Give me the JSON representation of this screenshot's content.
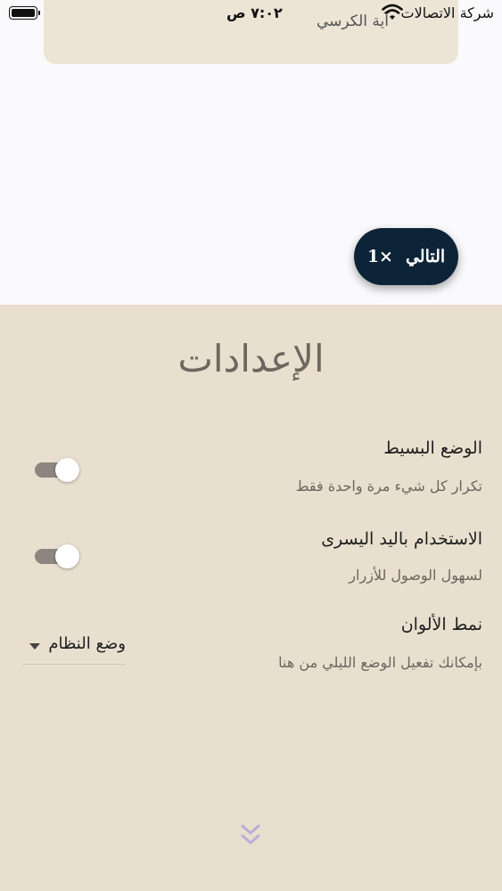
{
  "status_bar": {
    "carrier": "شركة الاتصالات",
    "time": "٧:٠٢ ص"
  },
  "card": {
    "title": "آية الكرسي"
  },
  "next_button": {
    "label": "التالي",
    "speed": "×1"
  },
  "settings": {
    "title": "الإعدادات",
    "rows": [
      {
        "title": "الوضع البسيط",
        "subtitle": "تكرار كل شيء مرة واحدة فقط",
        "enabled": true
      },
      {
        "title": "الاستخدام باليد اليسرى",
        "subtitle": "لسهول الوصول للأزرار",
        "enabled": true
      }
    ],
    "color_mode": {
      "title": "نمط الألوان",
      "subtitle": "بإمكانك تفعيل الوضع الليلي من هنا",
      "selected": "وضع النظام"
    }
  },
  "colors": {
    "accent": "#0d2438",
    "panel": "#e9dfcf",
    "chevron": "#b9b0d8"
  },
  "icons": {
    "wifi": "wifi-icon",
    "battery": "battery-icon",
    "collapse": "double-chevron-down-icon"
  }
}
